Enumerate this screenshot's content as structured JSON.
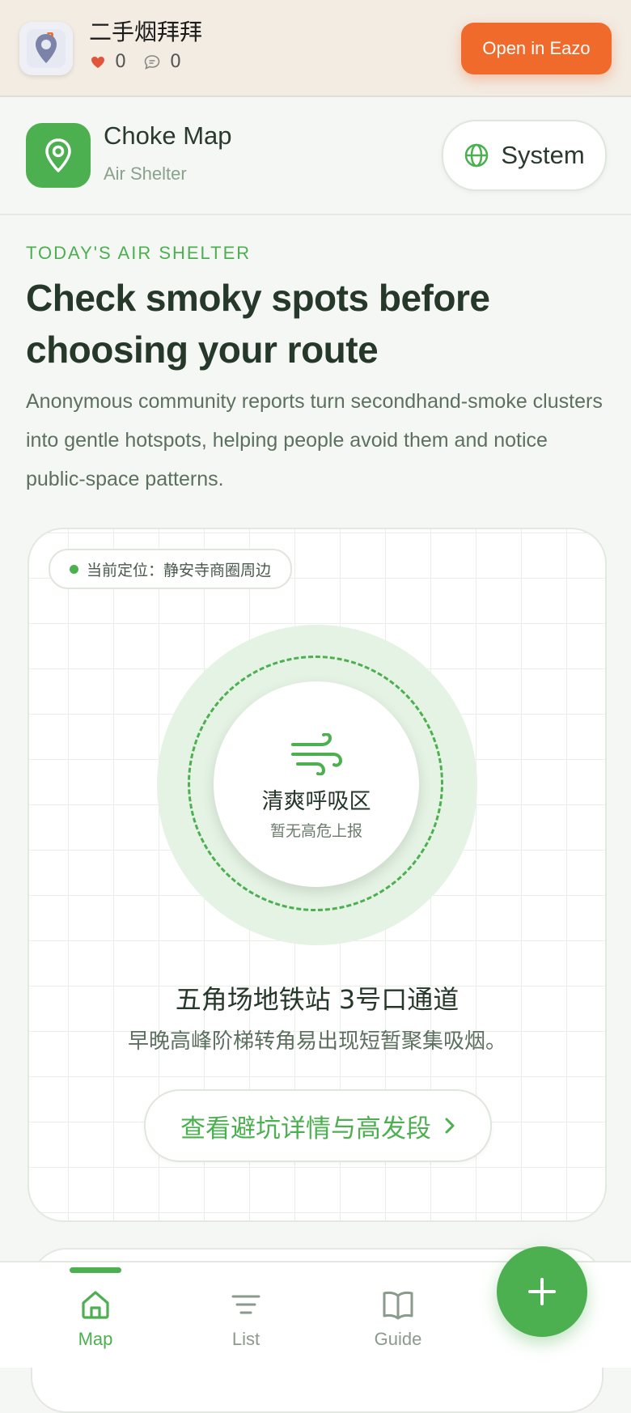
{
  "topbar": {
    "app_title": "二手烟拜拜",
    "likes": "0",
    "comments": "0",
    "open_button": "Open in Eazo",
    "accent": "#f06a2b"
  },
  "header": {
    "brand_name": "Choke Map",
    "brand_sub": "Air Shelter",
    "system_button": "System",
    "brand_color": "#4caf50"
  },
  "hero": {
    "eyebrow": "TODAY'S AIR SHELTER",
    "headline": "Check smoky spots before choosing your route",
    "description": "Anonymous community reports turn secondhand-smoke clusters into gentle hotspots, helping people avoid them and notice public-space patterns."
  },
  "map_card": {
    "location_pill": "当前定位：静安寺商圈周边",
    "zone_title": "清爽呼吸区",
    "zone_sub": "暂无高危上报",
    "spot_name": "五角场地铁站 3号口通道",
    "spot_desc": "早晚高峰阶梯转角易出现短暂聚集吸烟。",
    "detail_button": "查看避坑详情与高发段"
  },
  "tabbar": {
    "tabs": [
      {
        "label": "Map",
        "icon": "home-icon",
        "active": true
      },
      {
        "label": "List",
        "icon": "filter-list-icon",
        "active": false
      },
      {
        "label": "Guide",
        "icon": "book-icon",
        "active": false
      }
    ],
    "fab_icon": "plus-icon"
  }
}
